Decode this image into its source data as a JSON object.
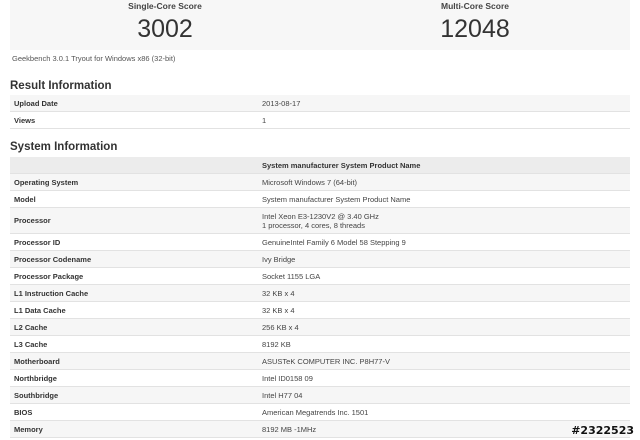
{
  "scores": {
    "single_label": "Single-Core Score",
    "single_value": "3002",
    "multi_label": "Multi-Core Score",
    "multi_value": "12048"
  },
  "version_text": "Geekbench 3.0.1 Tryout for Windows x86 (32-bit)",
  "result": {
    "title": "Result Information",
    "rows": [
      {
        "label": "Upload Date",
        "value": "2013-08-17"
      },
      {
        "label": "Views",
        "value": "1"
      }
    ]
  },
  "system": {
    "title": "System Information",
    "header": "System manufacturer System Product Name",
    "rows": [
      {
        "label": "Operating System",
        "value": "Microsoft Windows 7 (64-bit)"
      },
      {
        "label": "Model",
        "value": "System manufacturer System Product Name"
      },
      {
        "label": "Processor",
        "value": "Intel Xeon E3-1230V2 @ 3.40 GHz",
        "value2": "1 processor, 4 cores, 8 threads"
      },
      {
        "label": "Processor ID",
        "value": "GenuineIntel Family 6 Model 58 Stepping 9"
      },
      {
        "label": "Processor Codename",
        "value": "Ivy Bridge"
      },
      {
        "label": "Processor Package",
        "value": "Socket 1155 LGA"
      },
      {
        "label": "L1 Instruction Cache",
        "value": "32 KB x 4"
      },
      {
        "label": "L1 Data Cache",
        "value": "32 KB x 4"
      },
      {
        "label": "L2 Cache",
        "value": "256 KB x 4"
      },
      {
        "label": "L3 Cache",
        "value": "8192 KB"
      },
      {
        "label": "Motherboard",
        "value": "ASUSTeK COMPUTER INC. P8H77-V"
      },
      {
        "label": "Northbridge",
        "value": "Intel ID0158 09"
      },
      {
        "label": "Southbridge",
        "value": "Intel H77 04"
      },
      {
        "label": "BIOS",
        "value": "American Megatrends Inc. 1501"
      },
      {
        "label": "Memory",
        "value": "8192 MB -1MHz"
      }
    ]
  },
  "watermark": "#2322523"
}
